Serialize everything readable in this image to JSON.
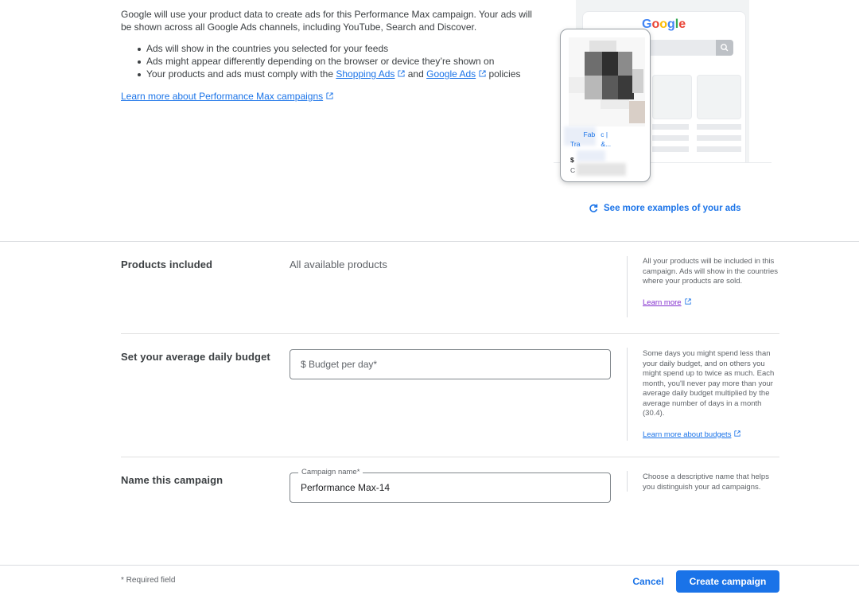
{
  "intro": {
    "description": "Google will use your product data to create ads for this Performance Max campaign. Your ads will be shown across all Google Ads channels, including YouTube, Search and Discover.",
    "bullets": {
      "b1": "Ads will show in the countries you selected for your feeds",
      "b2": "Ads might appear differently depending on the browser or device they’re shown on",
      "b3_before": "Your products and ads must comply with the ",
      "b3_link1": "Shopping Ads",
      "b3_mid": " and ",
      "b3_link2": "Google Ads",
      "b3_after": " policies"
    },
    "learn_more_link": "Learn more about Performance Max campaigns"
  },
  "preview": {
    "logo": [
      "G",
      "o",
      "o",
      "g",
      "l",
      "e"
    ],
    "ad_title": "       Fab   c |\nTra           &...",
    "ad_price": "$",
    "ad_store": "C",
    "see_more": "See more examples of your ads"
  },
  "products": {
    "label": "Products included",
    "value": "All available products",
    "help": "All your products will be included in this campaign. Ads will show in the countries where your products are sold.",
    "help_link": "Learn more"
  },
  "budget": {
    "label": "Set your average daily budget",
    "placeholder": "$ Budget per day*",
    "help": "Some days you might spend less than your daily budget, and on others you might spend up to twice as much. Each month, you'll never pay more than your average daily budget multiplied by the average number of days in a month (30.4).",
    "help_link": "Learn more about budgets"
  },
  "campaign_name": {
    "label": "Name this campaign",
    "field_label": "Campaign name*",
    "value": "Performance Max-14",
    "help": "Choose a descriptive name that helps you distinguish your ad campaigns."
  },
  "footer": {
    "required_note": "* Required field",
    "cancel": "Cancel",
    "create": "Create campaign"
  },
  "colors": {
    "accent": "#1a73e8",
    "visited_link": "#8430ce"
  }
}
